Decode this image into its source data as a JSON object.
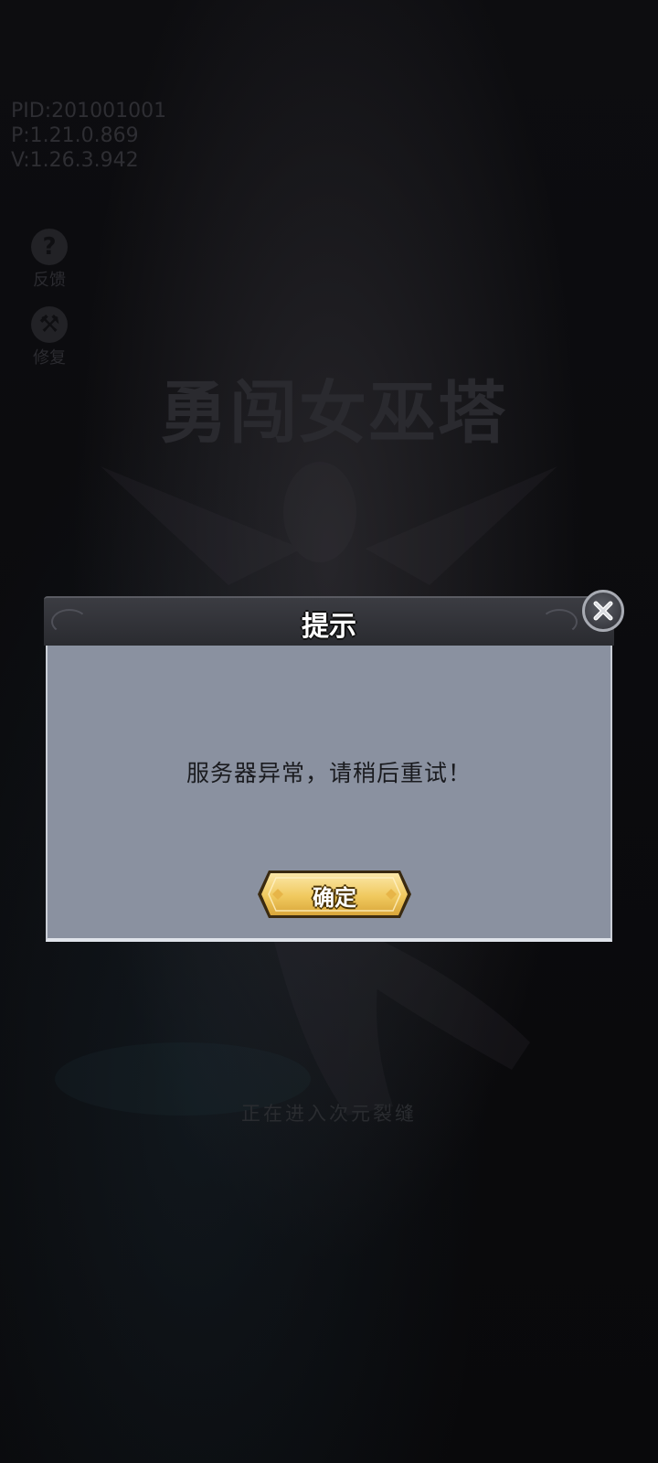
{
  "version_info": {
    "pid": "PID:201001001",
    "p": "P:1.21.0.869",
    "v": "V:1.26.3.942"
  },
  "side_buttons": [
    {
      "icon": "question-icon",
      "glyph": "?",
      "label": "反馈"
    },
    {
      "icon": "wrench-icon",
      "glyph": "⚒",
      "label": "修复"
    }
  ],
  "logo_text": "勇闯女巫塔",
  "loading_text": "正在进入次元裂缝",
  "dialog": {
    "title": "提示",
    "message": "服务器异常，请稍后重试！",
    "confirm_label": "确定",
    "close_icon": "close-icon"
  },
  "colors": {
    "dialog_body": "#8a91a0",
    "dialog_header": "#2f3036",
    "confirm_button": "#f3d27a"
  }
}
